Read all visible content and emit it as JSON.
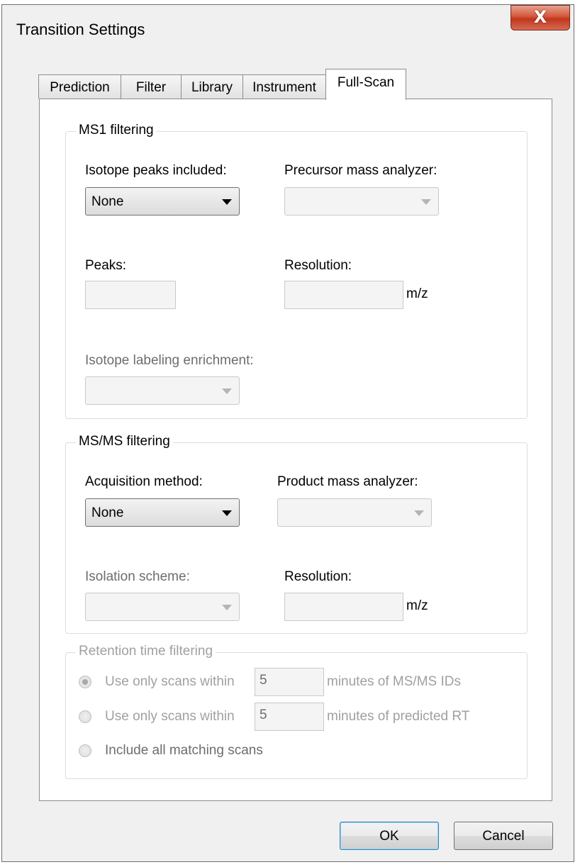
{
  "dialog": {
    "title": "Transition Settings",
    "close_label": "X"
  },
  "tabs": [
    {
      "label": "Prediction",
      "active": false
    },
    {
      "label": "Filter",
      "active": false
    },
    {
      "label": "Library",
      "active": false
    },
    {
      "label": "Instrument",
      "active": false
    },
    {
      "label": "Full-Scan",
      "active": true
    }
  ],
  "ms1": {
    "title": "MS1 filtering",
    "isotope_peaks_label": "Isotope peaks included:",
    "isotope_peaks_value": "None",
    "precursor_analyzer_label": "Precursor mass analyzer:",
    "precursor_analyzer_value": "",
    "peaks_label": "Peaks:",
    "peaks_value": "",
    "resolution_label": "Resolution:",
    "resolution_value": "",
    "resolution_unit": "m/z",
    "enrichment_label": "Isotope labeling enrichment:",
    "enrichment_value": ""
  },
  "msms": {
    "title": "MS/MS filtering",
    "acquisition_label": "Acquisition method:",
    "acquisition_value": "None",
    "product_analyzer_label": "Product mass analyzer:",
    "product_analyzer_value": "",
    "isolation_label": "Isolation scheme:",
    "isolation_value": "",
    "resolution_label": "Resolution:",
    "resolution_value": "",
    "resolution_unit": "m/z"
  },
  "retention": {
    "title": "Retention time filtering",
    "options": [
      {
        "prefix": "Use only scans within",
        "value": "5",
        "suffix": "minutes of MS/MS IDs",
        "checked": true
      },
      {
        "prefix": "Use only scans within",
        "value": "5",
        "suffix": "minutes of predicted RT",
        "checked": false
      },
      {
        "prefix": "Include all matching scans",
        "checked": false
      }
    ]
  },
  "buttons": {
    "ok": "OK",
    "cancel": "Cancel"
  },
  "colors": {
    "window_bg": "#f0f0f0",
    "panel_bg": "#ffffff",
    "disabled_text": "#a0a0a0",
    "close_button": "#c7442a"
  }
}
